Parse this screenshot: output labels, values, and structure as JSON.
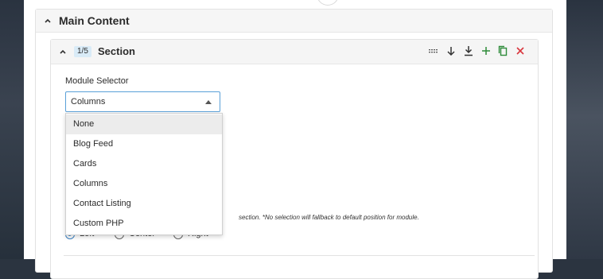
{
  "main": {
    "title": "Main Content"
  },
  "section": {
    "index_badge": "1/5",
    "title": "Section",
    "tools": [
      "drag-handle-icon",
      "move-down-icon",
      "move-to-bottom-icon",
      "add-icon",
      "duplicate-icon",
      "delete-icon"
    ],
    "colors": {
      "add": "#2e8b3a",
      "delete": "#d9363e",
      "badge_bg": "#d9ebf7",
      "focus": "#5aa0d8"
    }
  },
  "module_selector": {
    "label": "Module Selector",
    "value": "Columns",
    "options": [
      "None",
      "Blog Feed",
      "Cards",
      "Columns",
      "Contact Listing",
      "Custom PHP"
    ],
    "highlighted": "None"
  },
  "alignment": {
    "hint": "section. *No selection will fallback to default position for module.",
    "options": [
      "Left",
      "Center",
      "Right"
    ],
    "selected": "Left"
  }
}
